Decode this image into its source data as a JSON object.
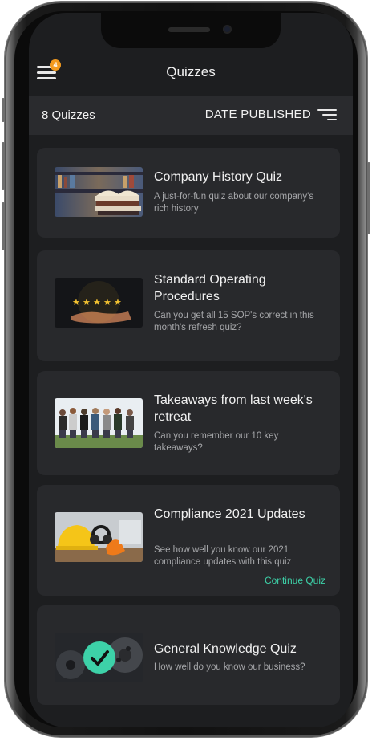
{
  "header": {
    "title": "Quizzes",
    "menu_badge": "4"
  },
  "toolbar": {
    "count_label": "8 Quizzes",
    "sort_label": "DATE PUBLISHED"
  },
  "quizzes": [
    {
      "title": "Company History Quiz",
      "description": "A just-for-fun quiz about our company's rich history",
      "image": "books-photo"
    },
    {
      "title": "Standard Operating Procedures",
      "description": "Can you get all 15 SOP's correct in this month's refresh quiz?",
      "image": "five-stars-hand-photo"
    },
    {
      "title": "Takeaways from last week's retreat",
      "description": "Can you remember our 10 key takeaways?",
      "image": "group-photo"
    },
    {
      "title": "Compliance 2021 Updates",
      "description": "See how well you know our 2021 compliance updates with this quiz",
      "image": "safety-gear-photo",
      "action": "Continue Quiz"
    },
    {
      "title": "General Knowledge Quiz",
      "description": "How well do you know our business?",
      "image": "gears-photo",
      "completed_icon": "check-circle-icon"
    }
  ],
  "colors": {
    "accent": "#3dd1a8",
    "badge": "#f39a1e",
    "background": "#1d1e20",
    "card": "#28292c"
  }
}
